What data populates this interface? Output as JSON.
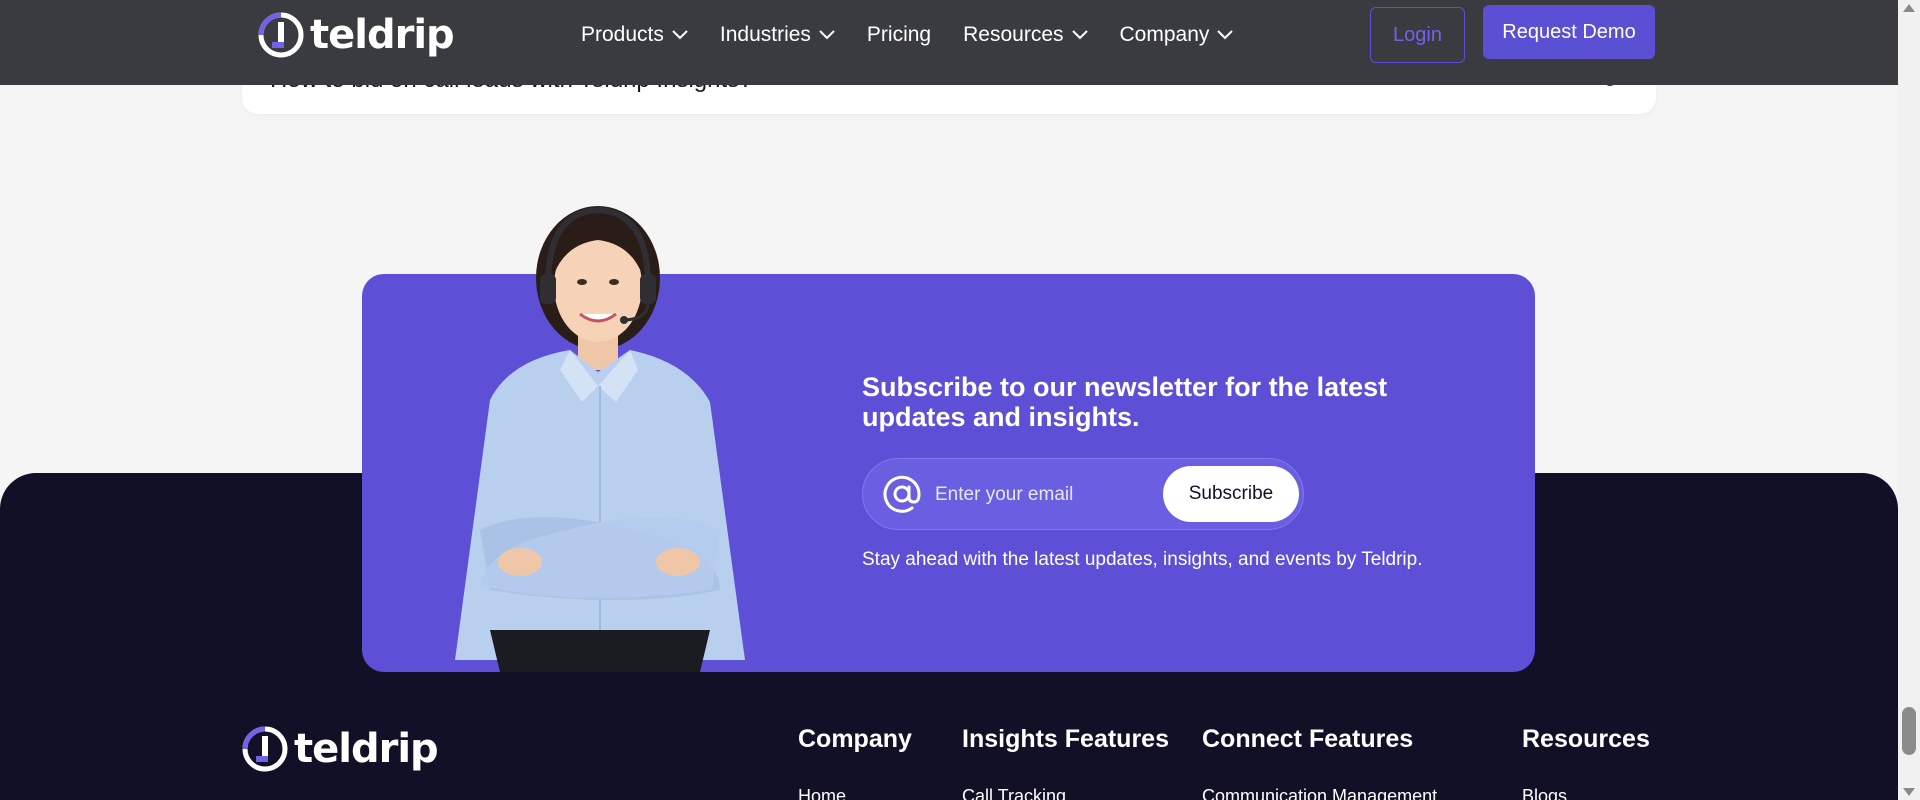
{
  "brand": {
    "name": "teldrip",
    "accent": "#5d4fd6",
    "dark_bg": "#121027",
    "header_bg": "#3a3b40"
  },
  "faq": {
    "question": "How to bid on call leads with Teldrip Insights?"
  },
  "header": {
    "nav": [
      {
        "label": "Products",
        "has_dropdown": true
      },
      {
        "label": "Industries",
        "has_dropdown": true
      },
      {
        "label": "Pricing",
        "has_dropdown": false
      },
      {
        "label": "Resources",
        "has_dropdown": true
      },
      {
        "label": "Company",
        "has_dropdown": true
      }
    ],
    "login_label": "Login",
    "demo_label": "Request Demo"
  },
  "newsletter": {
    "title": "Subscribe to our newsletter for the latest updates and insights.",
    "placeholder": "Enter your email",
    "subscribe_label": "Subscribe",
    "note": "Stay ahead with the latest updates, insights, and events by Teldrip.",
    "icon": "at-icon"
  },
  "footer": {
    "columns": [
      {
        "title": "Company",
        "first_link": "Home"
      },
      {
        "title": "Insights Features",
        "first_link": "Call Tracking"
      },
      {
        "title": "Connect Features",
        "first_link": "Communication Management"
      },
      {
        "title": "Resources",
        "first_link": "Blogs"
      }
    ]
  }
}
